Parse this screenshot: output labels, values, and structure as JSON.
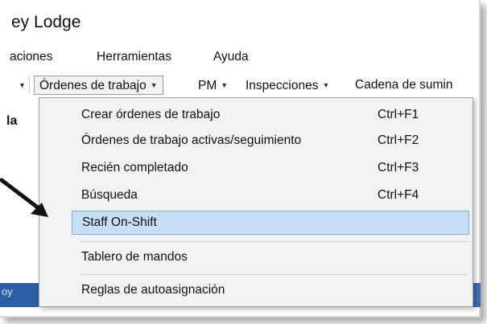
{
  "window": {
    "title": "ey Lodge"
  },
  "menubar": {
    "items": [
      "aciones",
      "Herramientas",
      "Ayuda"
    ]
  },
  "toolbar": {
    "items": [
      {
        "label": "Órdenes de trabajo",
        "active": true
      },
      {
        "label": "PM"
      },
      {
        "label": "Inspecciones"
      },
      {
        "label": "Cadena de sumin"
      }
    ]
  },
  "left_panel": {
    "text": "la"
  },
  "bottom_bar": {
    "text": "oy"
  },
  "dropdown": {
    "items": [
      {
        "label": "Crear órdenes de trabajo",
        "shortcut": "Ctrl+F1"
      },
      {
        "label": "Órdenes de trabajo activas/seguimiento",
        "shortcut": "Ctrl+F2"
      },
      {
        "label": "Recién completado",
        "shortcut": "Ctrl+F3"
      },
      {
        "label": "Búsqueda",
        "shortcut": "Ctrl+F4"
      },
      {
        "label": "Staff On-Shift",
        "shortcut": "",
        "highlighted": true
      },
      {
        "label": "Tablero de mandos",
        "shortcut": ""
      },
      {
        "label": "Reglas de autoasignación",
        "shortcut": ""
      }
    ]
  },
  "colors": {
    "highlight": "#c7dff5",
    "highlight_border": "#7ab0e0",
    "bottom_bar": "#2a5fa6"
  }
}
